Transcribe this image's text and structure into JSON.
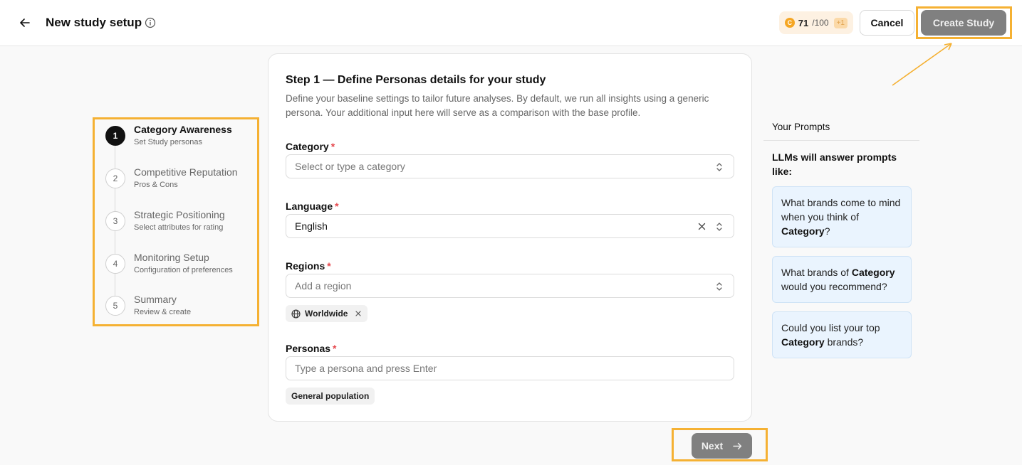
{
  "header": {
    "title": "New study setup",
    "credits_used": "71",
    "credits_total": "/100",
    "credits_plus": "+1",
    "cancel_label": "Cancel",
    "create_label": "Create Study"
  },
  "steps": [
    {
      "number": "1",
      "title": "Category Awareness",
      "subtitle": "Set Study personas",
      "active": true
    },
    {
      "number": "2",
      "title": "Competitive Reputation",
      "subtitle": "Pros & Cons",
      "active": false
    },
    {
      "number": "3",
      "title": "Strategic Positioning",
      "subtitle": "Select attributes for rating",
      "active": false
    },
    {
      "number": "4",
      "title": "Monitoring Setup",
      "subtitle": "Configuration of preferences",
      "active": false
    },
    {
      "number": "5",
      "title": "Summary",
      "subtitle": "Review & create",
      "active": false
    }
  ],
  "form": {
    "title": "Step 1 — Define Personas details for your study",
    "description": "Define your baseline settings to tailor future analyses. By default, we run all insights using a generic persona. Your additional input here will serve as a comparison with the base profile.",
    "required_mark": "*",
    "category": {
      "label": "Category",
      "placeholder": "Select or type a category"
    },
    "language": {
      "label": "Language",
      "value": "English"
    },
    "regions": {
      "label": "Regions",
      "placeholder": "Add a region",
      "chips": [
        "Worldwide"
      ]
    },
    "personas": {
      "label": "Personas",
      "placeholder": "Type a persona and press Enter",
      "chips": [
        "General population"
      ]
    }
  },
  "prompts": {
    "heading": "Your Prompts",
    "intro": "LLMs will answer prompts like:",
    "items": [
      {
        "before": "What brands come to mind when you think of ",
        "keyword": "Category",
        "after": "?"
      },
      {
        "before": "What brands of ",
        "keyword": "Category",
        "after": " would you recommend?"
      },
      {
        "before": "Could you list your top ",
        "keyword": "Category",
        "after": " brands?"
      }
    ]
  },
  "next_label": "Next",
  "colors": {
    "accent_highlight": "#f5b133",
    "button_disabled": "#808080",
    "prompt_bg": "#eaf4fe"
  }
}
